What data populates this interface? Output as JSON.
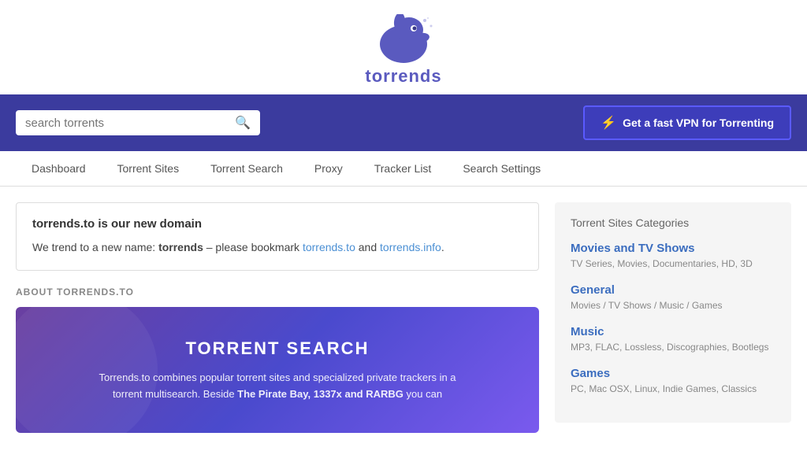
{
  "logo": {
    "text": "torrends",
    "superscript": "·"
  },
  "search": {
    "placeholder": "search torrents",
    "button_label": "Search"
  },
  "vpn": {
    "label": "Get a fast VPN for Torrenting"
  },
  "nav": {
    "items": [
      {
        "label": "Dashboard",
        "href": "#"
      },
      {
        "label": "Torrent Sites",
        "href": "#"
      },
      {
        "label": "Torrent Search",
        "href": "#"
      },
      {
        "label": "Proxy",
        "href": "#"
      },
      {
        "label": "Tracker List",
        "href": "#"
      },
      {
        "label": "Search Settings",
        "href": "#"
      }
    ]
  },
  "notice": {
    "title": "torrends.to is our new domain",
    "text_before": "We trend to a new name: ",
    "bold": "torrends",
    "text_middle": " – please bookmark ",
    "link1_label": "torrends.to",
    "link1_href": "#",
    "text_after": " and ",
    "link2_label": "torrends.info",
    "link2_href": "#",
    "text_end": "."
  },
  "about": {
    "label": "ABOUT TORRENDS.TO"
  },
  "banner": {
    "title": "TORRENT SEARCH",
    "description": "Torrends.to combines popular torrent sites and specialized private trackers in a torrent multisearch. Beside ",
    "bold_part": "The Pirate Bay, 1337x and RARBG",
    "description_end": " you can"
  },
  "sidebar": {
    "title": "Torrent Sites Categories",
    "categories": [
      {
        "title": "Movies and TV Shows",
        "desc": "TV Series, Movies, Documentaries, HD, 3D"
      },
      {
        "title": "General",
        "desc": "Movies / TV Shows / Music / Games"
      },
      {
        "title": "Music",
        "desc": "MP3, FLAC, Lossless, Discographies, Bootlegs"
      },
      {
        "title": "Games",
        "desc": "PC, Mac OSX, Linux, Indie Games, Classics"
      }
    ]
  }
}
